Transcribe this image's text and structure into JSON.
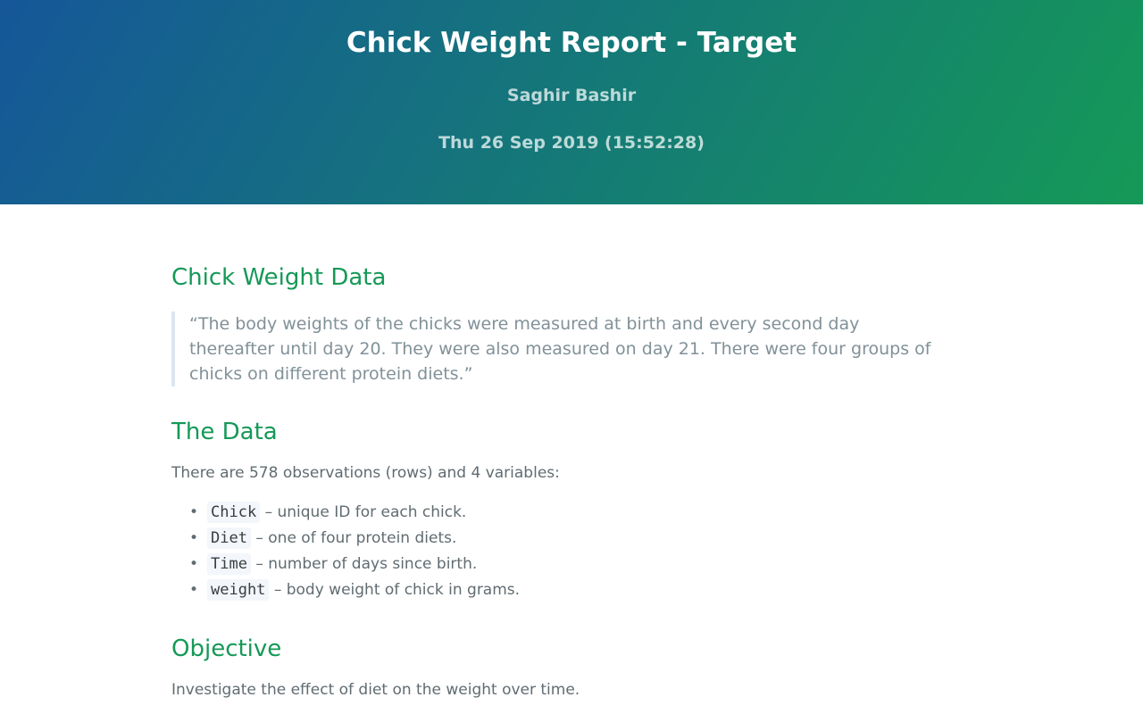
{
  "header": {
    "title": "Chick Weight Report - Target",
    "author": "Saghir Bashir",
    "date": "Thu 26 Sep 2019 (15:52:28)"
  },
  "section_data": {
    "heading": "Chick Weight Data",
    "quote": "“The body weights of the chicks were measured at birth and every second day thereafter until day 20. They were also measured on day 21. There were four groups of chicks on different protein diets.”"
  },
  "section_the_data": {
    "heading": "The Data",
    "intro": "There are 578 observations (rows) and 4 variables:",
    "variables": [
      {
        "name": "Chick",
        "desc": "– unique ID for each chick."
      },
      {
        "name": "Diet",
        "desc": "– one of four protein diets."
      },
      {
        "name": "Time",
        "desc": "– number of days since birth."
      },
      {
        "name": "weight",
        "desc": "– body weight of chick in grams."
      }
    ]
  },
  "section_objective": {
    "heading": "Objective",
    "text": "Investigate the effect of diet on the weight over time."
  },
  "colors": {
    "header_gradient_start": "#155799",
    "header_gradient_end": "#159957",
    "heading_green": "#159957",
    "body_text": "#606c71",
    "quote_text": "#819198"
  }
}
